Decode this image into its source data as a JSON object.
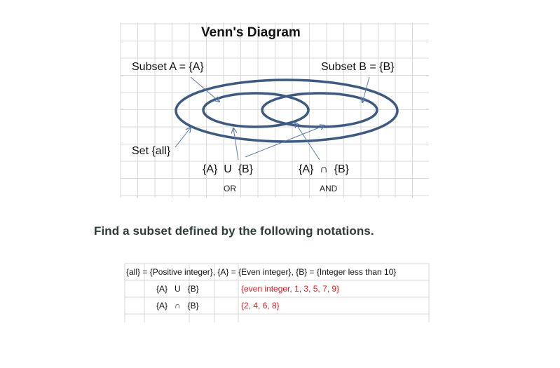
{
  "diagram": {
    "title": "Venn's Diagram",
    "subset_a_label": "Subset A = {A}",
    "subset_b_label": "Subset B = {B}",
    "set_all_label": "Set {all}",
    "union_label": "{A}  U  {B}",
    "union_caption": "OR",
    "intersection_label": "{A}  ∩  {B}",
    "intersection_caption": "AND",
    "ellipse_color": "#3d5a80",
    "arrow_color": "#5b7ba8"
  },
  "exercise": {
    "heading": "Find a subset defined by the following notations.",
    "definition": "{all} = {Positive integer}, {A} = {Even integer}, {B} = {Integer less than 10}",
    "rows": [
      {
        "notation": "{A}   U   {B}",
        "answer": "{even integer, 1, 3, 5, 7, 9}"
      },
      {
        "notation": "{A}   ∩   {B}",
        "answer": "{2, 4, 6, 8}"
      }
    ],
    "answer_color": "#e11b1b"
  }
}
